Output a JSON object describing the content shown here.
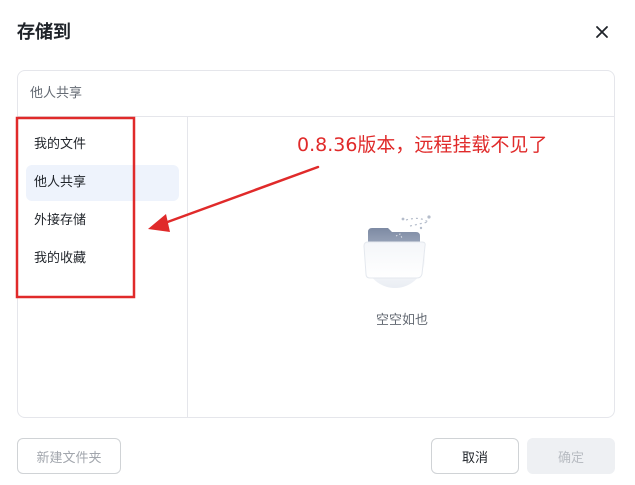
{
  "dialog": {
    "title": "存储到",
    "close_icon": "close-icon"
  },
  "path_bar": {
    "text": "他人共享"
  },
  "sidebar": {
    "items": [
      {
        "label": "我的文件",
        "active": false
      },
      {
        "label": "他人共享",
        "active": true
      },
      {
        "label": "外接存储",
        "active": false
      },
      {
        "label": "我的收藏",
        "active": false
      }
    ]
  },
  "content": {
    "empty_icon": "empty-folder-icon",
    "empty_text": "空空如也"
  },
  "annotation": {
    "text": "0.8.36版本，远程挂载不见了",
    "color": "#e02a2a"
  },
  "footer": {
    "new_folder_label": "新建文件夹",
    "cancel_label": "取消",
    "confirm_label": "确定"
  },
  "colors": {
    "active_bg": "#eef3fc",
    "border": "#e5e6eb",
    "annotation_red": "#e02a2a"
  }
}
